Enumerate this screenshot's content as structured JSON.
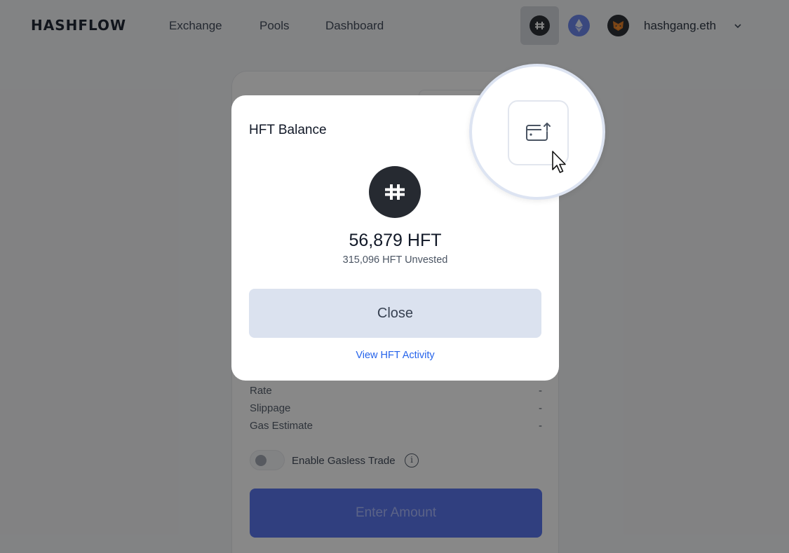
{
  "header": {
    "logo": "HASHFLOW",
    "nav": [
      "Exchange",
      "Pools",
      "Dashboard"
    ],
    "account": "hashgang.eth"
  },
  "trade": {
    "rows": [
      {
        "label": "Rate",
        "value": "-"
      },
      {
        "label": "Slippage",
        "value": "-"
      },
      {
        "label": "Gas Estimate",
        "value": "-"
      }
    ],
    "gasless_label": "Enable Gasless Trade",
    "info_glyph": "i",
    "enter_label": "Enter Amount"
  },
  "modal": {
    "title": "HFT Balance",
    "balance": "56,879 HFT",
    "unvested": "315,096 HFT Unvested",
    "close_label": "Close",
    "activity_link": "View HFT Activity"
  },
  "icons": {
    "token": "hashflow-logo-icon",
    "chain": "ethereum-icon",
    "wallet": "metamask-fox-icon",
    "account_menu": "chevron-down-icon",
    "magnified": "wallet-upload-icon",
    "pointer": "mouse-cursor-icon"
  },
  "colors": {
    "accent": "#4f6dec",
    "link": "#2563eb",
    "close_button": "#dbe2ef",
    "token_dark": "#262a31",
    "ethereum": "#627eea"
  }
}
